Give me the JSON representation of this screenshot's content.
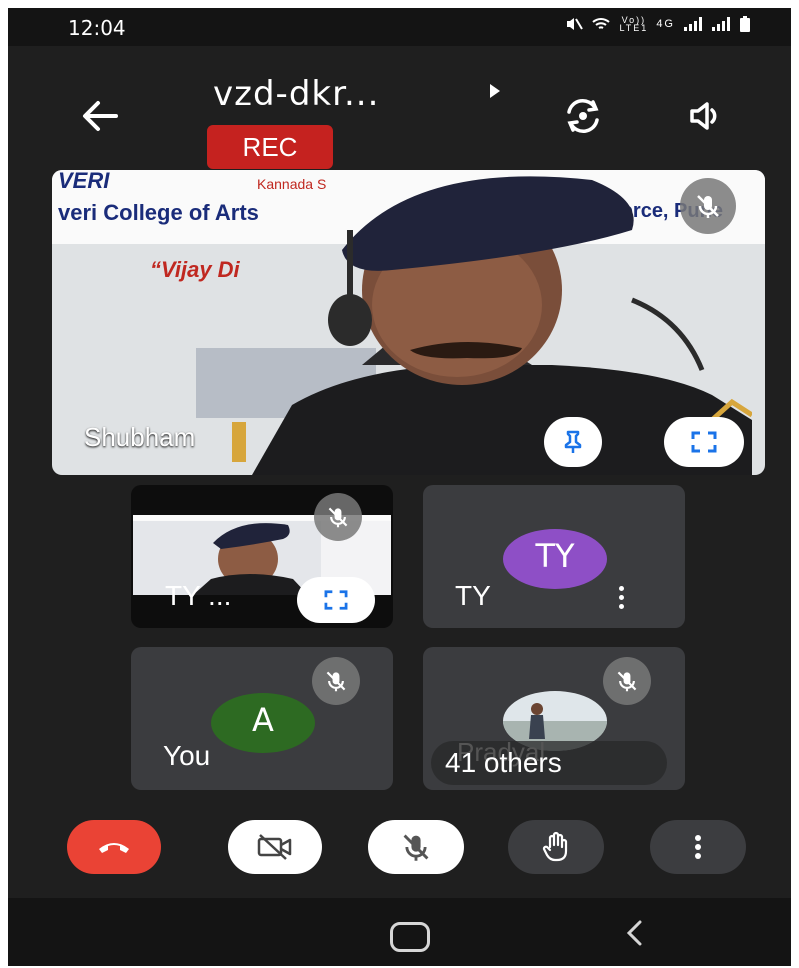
{
  "status_bar": {
    "time": "12:04",
    "icons": [
      "mute-icon",
      "wifi-icon",
      "volte-icon",
      "signal-icon",
      "signal-icon",
      "battery-icon"
    ],
    "network_label_1": "Vo))",
    "network_label_2": "LTE1",
    "network_type": "4G"
  },
  "header": {
    "meeting_title": "vzd-dkr...",
    "rec_label": "REC"
  },
  "main_tile": {
    "participant_name": "Shubham",
    "background_texts": [
      "VERI",
      "Kannada S",
      "veri College of Arts",
      "merce, Pune",
      "“Vijay Di"
    ]
  },
  "tiles": [
    {
      "name": "TY ...",
      "kind": "video-thumbnail"
    },
    {
      "name": "TY",
      "avatar_initials": "TY",
      "avatar_color": "#8e4fc6"
    },
    {
      "name": "You",
      "avatar_initials": "A",
      "avatar_color": "#2d6a22"
    },
    {
      "name": "41 others",
      "overlay_name": "Pradyal"
    }
  ],
  "colors": {
    "background": "#1f1f1f",
    "tile": "#3b3c3f",
    "end_call": "#ea4335",
    "rec": "#c5221f"
  }
}
